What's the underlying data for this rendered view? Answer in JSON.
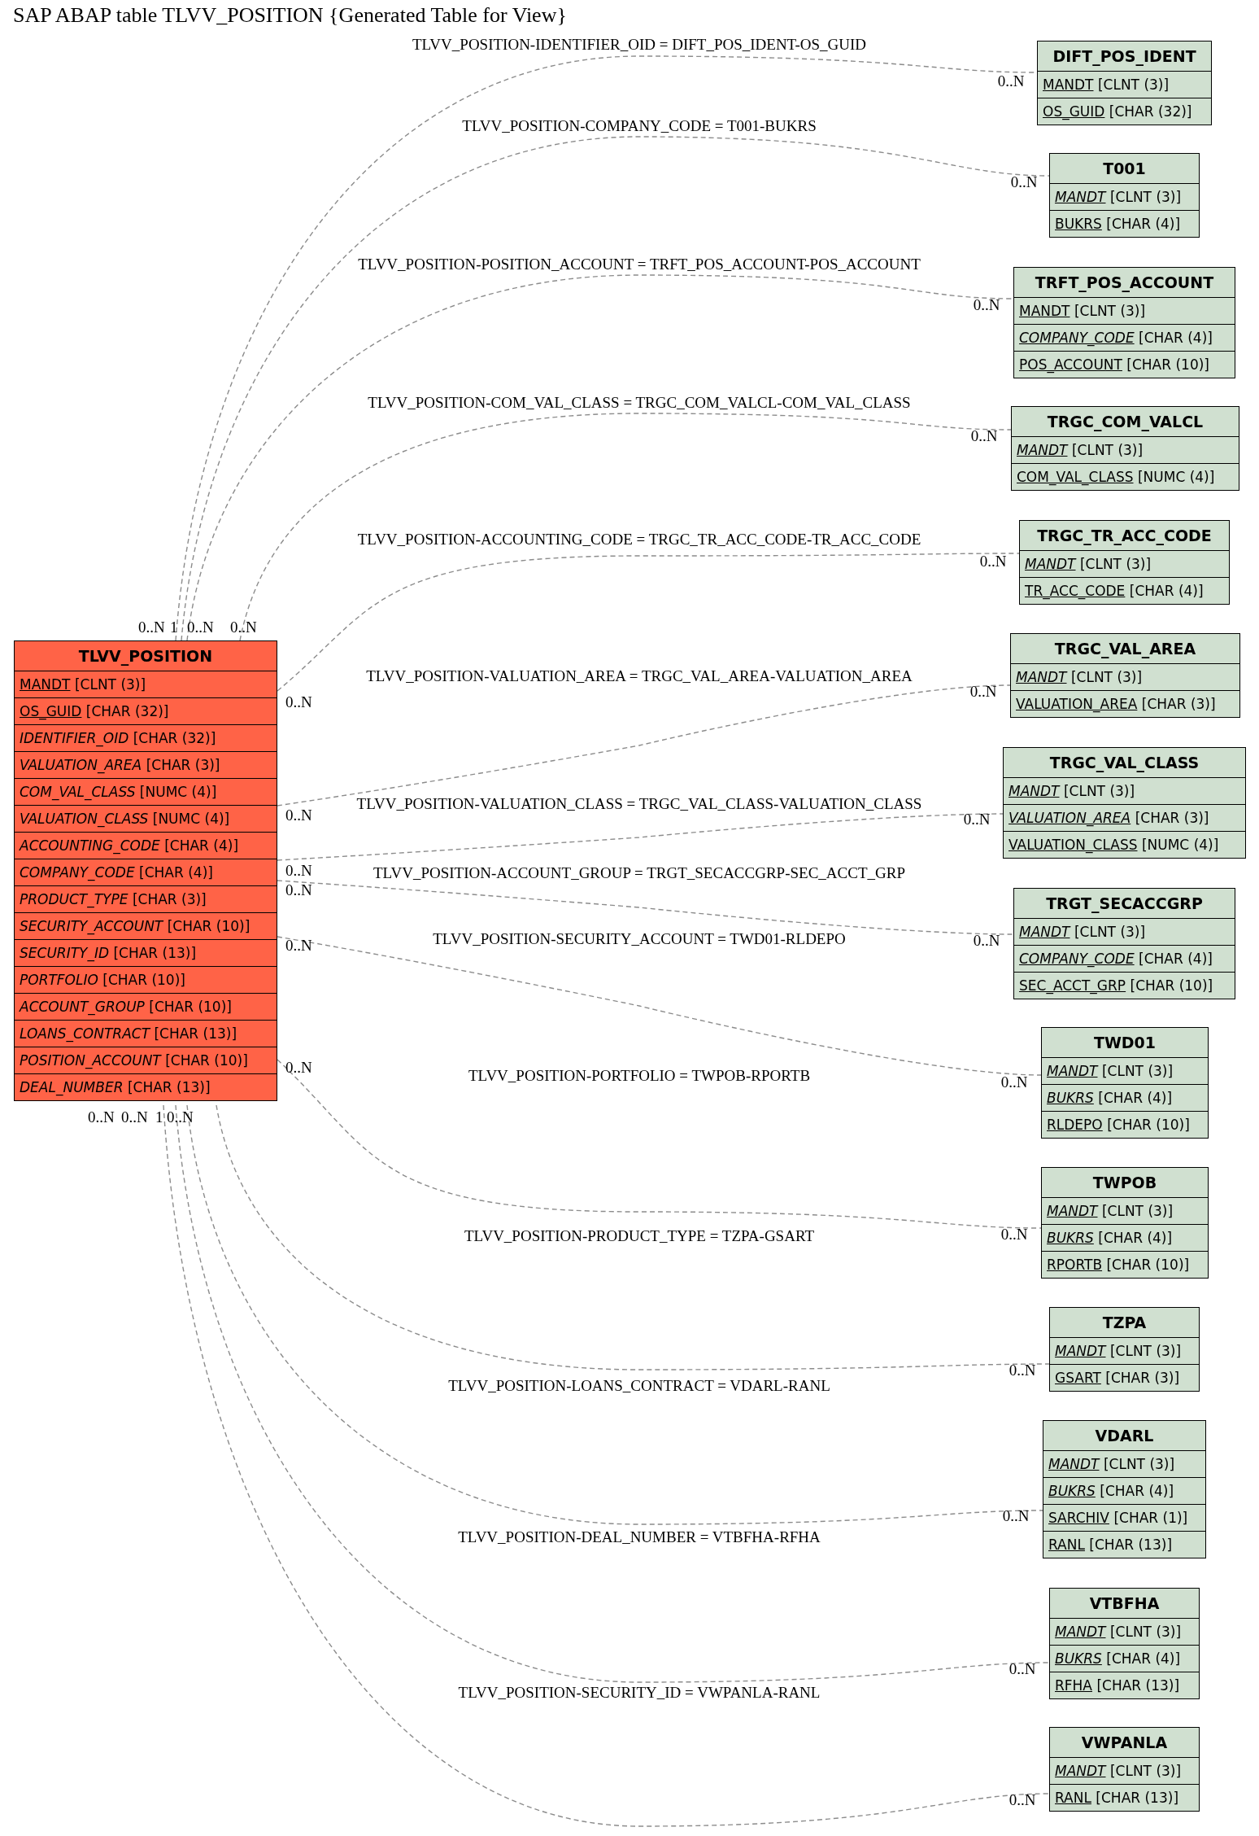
{
  "title": "SAP ABAP table TLVV_POSITION {Generated Table for View}",
  "tables": [
    {
      "name": "TLVV_POSITION",
      "color": "#ff6347",
      "fields": [
        {
          "name": "MANDT",
          "type": "[CLNT (3)]",
          "key": true,
          "foreign_key": false
        },
        {
          "name": "OS_GUID",
          "type": "[CHAR (32)]",
          "key": true,
          "foreign_key": false
        },
        {
          "name": "IDENTIFIER_OID",
          "type": "[CHAR (32)]",
          "key": false,
          "foreign_key": true
        },
        {
          "name": "VALUATION_AREA",
          "type": "[CHAR (3)]",
          "key": false,
          "foreign_key": true
        },
        {
          "name": "COM_VAL_CLASS",
          "type": "[NUMC (4)]",
          "key": false,
          "foreign_key": true
        },
        {
          "name": "VALUATION_CLASS",
          "type": "[NUMC (4)]",
          "key": false,
          "foreign_key": true
        },
        {
          "name": "ACCOUNTING_CODE",
          "type": "[CHAR (4)]",
          "key": false,
          "foreign_key": true
        },
        {
          "name": "COMPANY_CODE",
          "type": "[CHAR (4)]",
          "key": false,
          "foreign_key": true
        },
        {
          "name": "PRODUCT_TYPE",
          "type": "[CHAR (3)]",
          "key": false,
          "foreign_key": true
        },
        {
          "name": "SECURITY_ACCOUNT",
          "type": "[CHAR (10)]",
          "key": false,
          "foreign_key": true
        },
        {
          "name": "SECURITY_ID",
          "type": "[CHAR (13)]",
          "key": false,
          "foreign_key": true
        },
        {
          "name": "PORTFOLIO",
          "type": "[CHAR (10)]",
          "key": false,
          "foreign_key": true
        },
        {
          "name": "ACCOUNT_GROUP",
          "type": "[CHAR (10)]",
          "key": false,
          "foreign_key": true
        },
        {
          "name": "LOANS_CONTRACT",
          "type": "[CHAR (13)]",
          "key": false,
          "foreign_key": true
        },
        {
          "name": "POSITION_ACCOUNT",
          "type": "[CHAR (10)]",
          "key": false,
          "foreign_key": true
        },
        {
          "name": "DEAL_NUMBER",
          "type": "[CHAR (13)]",
          "key": false,
          "foreign_key": true
        }
      ]
    },
    {
      "name": "DIFT_POS_IDENT",
      "color": "#d0e0d0",
      "fields": [
        {
          "name": "MANDT",
          "type": "[CLNT (3)]",
          "key": true,
          "foreign_key": false
        },
        {
          "name": "OS_GUID",
          "type": "[CHAR (32)]",
          "key": true,
          "foreign_key": false
        }
      ]
    },
    {
      "name": "T001",
      "color": "#d0e0d0",
      "fields": [
        {
          "name": "MANDT",
          "type": "[CLNT (3)]",
          "key": true,
          "foreign_key": true
        },
        {
          "name": "BUKRS",
          "type": "[CHAR (4)]",
          "key": true,
          "foreign_key": false
        }
      ]
    },
    {
      "name": "TRFT_POS_ACCOUNT",
      "color": "#d0e0d0",
      "fields": [
        {
          "name": "MANDT",
          "type": "[CLNT (3)]",
          "key": true,
          "foreign_key": false
        },
        {
          "name": "COMPANY_CODE",
          "type": "[CHAR (4)]",
          "key": true,
          "foreign_key": true
        },
        {
          "name": "POS_ACCOUNT",
          "type": "[CHAR (10)]",
          "key": true,
          "foreign_key": false
        }
      ]
    },
    {
      "name": "TRGC_COM_VALCL",
      "color": "#d0e0d0",
      "fields": [
        {
          "name": "MANDT",
          "type": "[CLNT (3)]",
          "key": true,
          "foreign_key": true
        },
        {
          "name": "COM_VAL_CLASS",
          "type": "[NUMC (4)]",
          "key": true,
          "foreign_key": false
        }
      ]
    },
    {
      "name": "TRGC_TR_ACC_CODE",
      "color": "#d0e0d0",
      "fields": [
        {
          "name": "MANDT",
          "type": "[CLNT (3)]",
          "key": true,
          "foreign_key": true
        },
        {
          "name": "TR_ACC_CODE",
          "type": "[CHAR (4)]",
          "key": true,
          "foreign_key": false
        }
      ]
    },
    {
      "name": "TRGC_VAL_AREA",
      "color": "#d0e0d0",
      "fields": [
        {
          "name": "MANDT",
          "type": "[CLNT (3)]",
          "key": true,
          "foreign_key": true
        },
        {
          "name": "VALUATION_AREA",
          "type": "[CHAR (3)]",
          "key": true,
          "foreign_key": false
        }
      ]
    },
    {
      "name": "TRGC_VAL_CLASS",
      "color": "#d0e0d0",
      "fields": [
        {
          "name": "MANDT",
          "type": "[CLNT (3)]",
          "key": true,
          "foreign_key": true
        },
        {
          "name": "VALUATION_AREA",
          "type": "[CHAR (3)]",
          "key": true,
          "foreign_key": true
        },
        {
          "name": "VALUATION_CLASS",
          "type": "[NUMC (4)]",
          "key": true,
          "foreign_key": false
        }
      ]
    },
    {
      "name": "TRGT_SECACCGRP",
      "color": "#d0e0d0",
      "fields": [
        {
          "name": "MANDT",
          "type": "[CLNT (3)]",
          "key": true,
          "foreign_key": true
        },
        {
          "name": "COMPANY_CODE",
          "type": "[CHAR (4)]",
          "key": true,
          "foreign_key": true
        },
        {
          "name": "SEC_ACCT_GRP",
          "type": "[CHAR (10)]",
          "key": true,
          "foreign_key": false
        }
      ]
    },
    {
      "name": "TWD01",
      "color": "#d0e0d0",
      "fields": [
        {
          "name": "MANDT",
          "type": "[CLNT (3)]",
          "key": true,
          "foreign_key": true
        },
        {
          "name": "BUKRS",
          "type": "[CHAR (4)]",
          "key": true,
          "foreign_key": true
        },
        {
          "name": "RLDEPO",
          "type": "[CHAR (10)]",
          "key": true,
          "foreign_key": false
        }
      ]
    },
    {
      "name": "TWPOB",
      "color": "#d0e0d0",
      "fields": [
        {
          "name": "MANDT",
          "type": "[CLNT (3)]",
          "key": true,
          "foreign_key": true
        },
        {
          "name": "BUKRS",
          "type": "[CHAR (4)]",
          "key": true,
          "foreign_key": true
        },
        {
          "name": "RPORTB",
          "type": "[CHAR (10)]",
          "key": true,
          "foreign_key": false
        }
      ]
    },
    {
      "name": "TZPA",
      "color": "#d0e0d0",
      "fields": [
        {
          "name": "MANDT",
          "type": "[CLNT (3)]",
          "key": true,
          "foreign_key": true
        },
        {
          "name": "GSART",
          "type": "[CHAR (3)]",
          "key": true,
          "foreign_key": false
        }
      ]
    },
    {
      "name": "VDARL",
      "color": "#d0e0d0",
      "fields": [
        {
          "name": "MANDT",
          "type": "[CLNT (3)]",
          "key": true,
          "foreign_key": true
        },
        {
          "name": "BUKRS",
          "type": "[CHAR (4)]",
          "key": true,
          "foreign_key": true
        },
        {
          "name": "SARCHIV",
          "type": "[CHAR (1)]",
          "key": true,
          "foreign_key": false
        },
        {
          "name": "RANL",
          "type": "[CHAR (13)]",
          "key": true,
          "foreign_key": false
        }
      ]
    },
    {
      "name": "VTBFHA",
      "color": "#d0e0d0",
      "fields": [
        {
          "name": "MANDT",
          "type": "[CLNT (3)]",
          "key": true,
          "foreign_key": true
        },
        {
          "name": "BUKRS",
          "type": "[CHAR (4)]",
          "key": true,
          "foreign_key": true
        },
        {
          "name": "RFHA",
          "type": "[CHAR (13)]",
          "key": true,
          "foreign_key": false
        }
      ]
    },
    {
      "name": "VWPANLA",
      "color": "#d0e0d0",
      "fields": [
        {
          "name": "MANDT",
          "type": "[CLNT (3)]",
          "key": true,
          "foreign_key": true
        },
        {
          "name": "RANL",
          "type": "[CHAR (13)]",
          "key": true,
          "foreign_key": false
        }
      ]
    }
  ],
  "relations": [
    {
      "label": "TLVV_POSITION-IDENTIFIER_OID = DIFT_POS_IDENT-OS_GUID",
      "target_cardinality": "0..N"
    },
    {
      "label": "TLVV_POSITION-COMPANY_CODE = T001-BUKRS",
      "target_cardinality": "0..N"
    },
    {
      "label": "TLVV_POSITION-POSITION_ACCOUNT = TRFT_POS_ACCOUNT-POS_ACCOUNT",
      "target_cardinality": "0..N"
    },
    {
      "label": "TLVV_POSITION-COM_VAL_CLASS = TRGC_COM_VALCL-COM_VAL_CLASS",
      "target_cardinality": "0..N"
    },
    {
      "label": "TLVV_POSITION-ACCOUNTING_CODE = TRGC_TR_ACC_CODE-TR_ACC_CODE",
      "target_cardinality": "0..N"
    },
    {
      "label": "TLVV_POSITION-VALUATION_AREA = TRGC_VAL_AREA-VALUATION_AREA",
      "target_cardinality": "0..N"
    },
    {
      "label": "TLVV_POSITION-VALUATION_CLASS = TRGC_VAL_CLASS-VALUATION_CLASS",
      "target_cardinality": "0..N"
    },
    {
      "label": "TLVV_POSITION-ACCOUNT_GROUP = TRGT_SECACCGRP-SEC_ACCT_GRP",
      "target_cardinality": "0..N"
    },
    {
      "label": "TLVV_POSITION-SECURITY_ACCOUNT = TWD01-RLDEPO",
      "target_cardinality": "0..N"
    },
    {
      "label": "TLVV_POSITION-PORTFOLIO = TWPOB-RPORTB",
      "target_cardinality": "0..N"
    },
    {
      "label": "TLVV_POSITION-PRODUCT_TYPE = TZPA-GSART",
      "target_cardinality": "0..N"
    },
    {
      "label": "TLVV_POSITION-LOANS_CONTRACT = VDARL-RANL",
      "target_cardinality": "0..N"
    },
    {
      "label": "TLVV_POSITION-DEAL_NUMBER = VTBFHA-RFHA",
      "target_cardinality": "0..N"
    },
    {
      "label": "TLVV_POSITION-SECURITY_ID = VWPANLA-RANL",
      "target_cardinality": "0..N"
    }
  ],
  "source_cardinalities": [
    "0..N",
    "1",
    "0..N",
    "0..N",
    "0..N",
    "0..N",
    "0..N",
    "0..N",
    "0..N",
    "0..N",
    "0..N",
    "0..N",
    "1",
    "0..N"
  ]
}
